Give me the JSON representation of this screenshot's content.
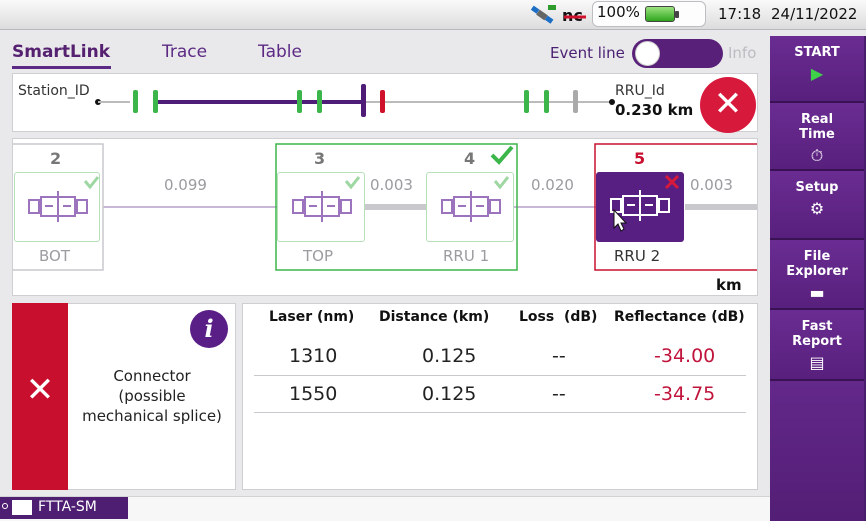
{
  "status_bar": {
    "battery_percent": "100%",
    "time": "17:18",
    "date": "24/11/2022",
    "icons": [
      "satellite-icon",
      "nc-logo-icon",
      "battery-charging-icon"
    ]
  },
  "tabs": [
    {
      "label": "SmartLink",
      "active": true
    },
    {
      "label": "Trace",
      "active": false
    },
    {
      "label": "Table",
      "active": false
    }
  ],
  "event_line": {
    "label": "Event line",
    "enabled": true
  },
  "info_label": "Info",
  "overview": {
    "start_label": "Station_ID",
    "end_label": "RRU_Id",
    "total_distance": "0.230 km"
  },
  "elements": [
    {
      "number": "2",
      "name": "BOT",
      "status": "pass"
    },
    {
      "number": "3",
      "name": "TOP",
      "status": "pass"
    },
    {
      "number": "4",
      "name": "RRU 1",
      "status": "pass"
    },
    {
      "number": "5",
      "name": "RRU 2",
      "status": "fail",
      "selected": true
    }
  ],
  "section_distances": [
    "0.099",
    "0.003",
    "0.020",
    "0.003"
  ],
  "distance_unit": "km",
  "event": {
    "status": "fail",
    "description_lines": [
      "Connector",
      "(possible",
      "mechanical splice)"
    ]
  },
  "results_table": {
    "headers": [
      "Laser (nm)",
      "Distance (km)",
      "Loss  (dB)",
      "Reflectance (dB)"
    ],
    "rows": [
      [
        "1310",
        "0.125",
        "--",
        "-34.00"
      ],
      [
        "1550",
        "0.125",
        "--",
        "-34.75"
      ]
    ]
  },
  "side_menu": [
    {
      "label": "START",
      "icon": "play-icon"
    },
    {
      "label": "Real\nTime",
      "icon": "stopwatch-icon"
    },
    {
      "label": "Setup",
      "icon": "gear-icon"
    },
    {
      "label": "File\nExplorer",
      "icon": "folder-icon"
    },
    {
      "label": "Fast\nReport",
      "icon": "report-icon"
    }
  ],
  "footer": {
    "mode": "FTTA-SM"
  },
  "colors": {
    "accent": "#5a1f86",
    "pass": "#3cb54a",
    "fail": "#d7193b",
    "reflectance": "#c0143c"
  }
}
